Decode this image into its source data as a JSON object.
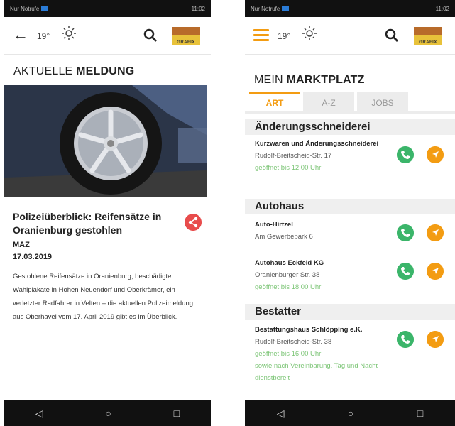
{
  "status_bar": {
    "left": "Nur Notrufe",
    "right": "11:02"
  },
  "left": {
    "weather": {
      "temp": "19°"
    },
    "logo_text": "GRAFIX",
    "section": {
      "prefix": "AKTUELLE",
      "bold": "MELDUNG"
    },
    "article": {
      "title": "Polizeiüberblick: Reifensätze in Oranienburg gestohlen",
      "source": "MAZ",
      "date": "17.03.2019",
      "teaser": "Gestohlene Reifensätze in Oranienburg, beschädigte Wahlplakate in Hohen Neuendorf und Oberkrämer, ein verletzter Radfahrer in Velten – die aktuellen Polizeimeldung aus Oberhavel vom 17. April 2019 gibt es im Überblick."
    }
  },
  "right": {
    "weather": {
      "temp": "19°"
    },
    "logo_text": "GRAFIX",
    "section": {
      "prefix": "MEIN",
      "bold": "MARKTPLATZ"
    },
    "tabs": [
      "ART",
      "A-Z",
      "JOBS"
    ],
    "categories": [
      {
        "title": "Änderungsschneiderei"
      },
      {
        "title": "Autohaus"
      },
      {
        "title": "Bestatter"
      }
    ],
    "entries": [
      {
        "name": "Kurzwaren und Änderungsschneiderei",
        "address": "Rudolf-Breitscheid-Str. 17",
        "open": "geöffnet bis 12:00 Uhr"
      },
      {
        "name": "Auto-Hirtzel",
        "address": "Am Gewerbepark 6",
        "open": ""
      },
      {
        "name": "Autohaus Eckfeld KG",
        "address": "Oranienburger Str. 38",
        "open": "geöffnet bis 18:00 Uhr"
      },
      {
        "name": "Bestattungshaus Schlöpping e.K.",
        "address": "Rudolf-Breitscheid-Str. 38",
        "open": "geöffnet bis 16:00 Uhr",
        "note": "sowie nach Vereinbarung. Tag und Nacht dienstbereit"
      }
    ]
  },
  "colors": {
    "accent": "#f39c12",
    "call": "#3bb56a",
    "share": "#e84c4c",
    "open": "#7cc576"
  }
}
